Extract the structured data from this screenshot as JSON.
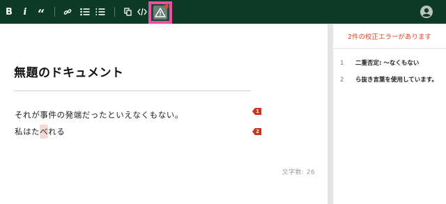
{
  "toolbar": {
    "bold_label": "B",
    "italic_label": "i",
    "quote_label": "“",
    "icons": [
      "bold-icon",
      "italic-icon",
      "quote-icon",
      "link-icon",
      "bullet-list-icon",
      "numbered-list-icon",
      "copy-icon",
      "code-icon",
      "warning-icon",
      "user-icon"
    ],
    "colors": {
      "background": "#0c3a24",
      "highlight_border": "#ee4fa3",
      "badge": "#e8482b"
    }
  },
  "document": {
    "title": "無題のドキュメント",
    "line1": "それが事件の発端だったといえなくもない。",
    "line2_pre": "私はた",
    "line2_highlight": "べ",
    "line2_post": "れる",
    "markers": [
      "1",
      "2"
    ],
    "char_count_label": "文字数: 26"
  },
  "panel": {
    "header": "2件の校正エラーがあります",
    "errors": [
      {
        "num": "1",
        "text": "二重否定: 〜なくもない"
      },
      {
        "num": "2",
        "text": "ら抜き言葉を使用しています。"
      }
    ],
    "colors": {
      "header": "#e0411f",
      "marker": "#c9341b",
      "highlight": "#f6d9d5"
    }
  }
}
